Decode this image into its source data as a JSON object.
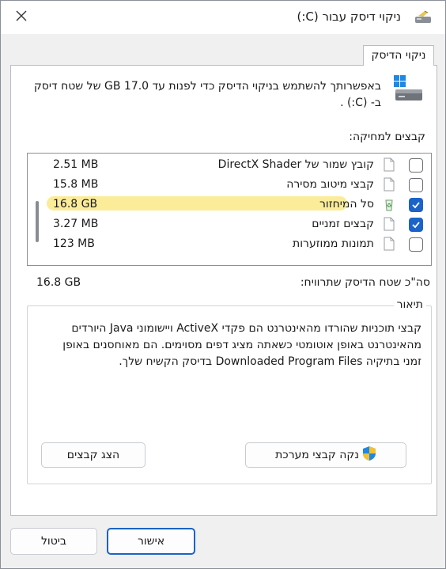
{
  "window": {
    "title": "ניקוי דיסק עבור (C:)",
    "close_icon": "close-icon",
    "app_icon": "disk-cleanup-icon"
  },
  "tab": {
    "label": "ניקוי הדיסק"
  },
  "intro": {
    "text": "באפשרותך להשתמש בניקוי הדיסק כדי לפנות עד 17.0 GB של שטח דיסק ב- (C:) ."
  },
  "files": {
    "label": "קבצים למחיקה:",
    "items": [
      {
        "name": "קובץ שמור של DirectX Shader",
        "size": "2.51 MB",
        "checked": false
      },
      {
        "name": "קבצי מיטוב מסירה",
        "size": "15.8 MB",
        "checked": false
      },
      {
        "name": "סל המיחזור",
        "size": "16.8 GB",
        "checked": true
      },
      {
        "name": "קבצים זמניים",
        "size": "3.27 MB",
        "checked": true
      },
      {
        "name": "תמונות ממוזערות",
        "size": "123 MB",
        "checked": false
      }
    ]
  },
  "total": {
    "label": "סה\"כ שטח הדיסק שתרוויח:",
    "value": "16.8 GB"
  },
  "description": {
    "legend": "תיאור",
    "text": "קבצי תוכניות שהורדו מהאינטרנט הם פקדי ActiveX ויישומוני Java היורדים מהאינטרנט באופן אוטומטי כשאתה מציג דפים מסוימים. הם מאוחסנים באופן זמני בתיקיה Downloaded Program Files בדיסק הקשיח שלך."
  },
  "buttons": {
    "clean_system": "נקה קבצי מערכת",
    "view_files": "הצג קבצים",
    "ok": "אישור",
    "cancel": "ביטול"
  },
  "colors": {
    "accent": "#1b63c6",
    "highlight": "#fae678"
  }
}
